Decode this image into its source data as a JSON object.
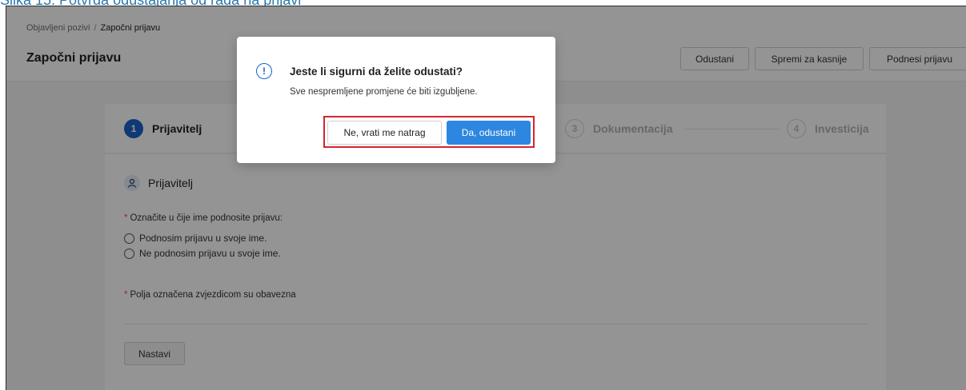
{
  "caption": "Slika 15. Potvrda odustajanja od rada na prijavi",
  "breadcrumb": {
    "parent": "Objavljeni pozivi",
    "separator": "/",
    "current": "Započni prijavu"
  },
  "page_title": "Započni prijavu",
  "header_buttons": {
    "cancel": "Odustani",
    "save_later": "Spremi za kasnije",
    "submit": "Podnesi prijavu"
  },
  "steps": [
    {
      "num": "1",
      "label": "Prijavitelj"
    },
    {
      "num": "3",
      "label": "Dokumentacija"
    },
    {
      "num": "4",
      "label": "Investicija"
    }
  ],
  "form": {
    "section_title": "Prijavitelj",
    "question": "Označite u čije ime podnosite prijavu:",
    "required_mark": "*",
    "options": [
      "Podnosim prijavu u svoje ime.",
      "Ne podnosim prijavu u svoje ime."
    ],
    "required_note": "Polja označena zvjezdicom su obavezna",
    "next_button": "Nastavi"
  },
  "modal": {
    "icon_glyph": "!",
    "title": "Jeste li sigurni da želite odustati?",
    "text": "Sve nespremljene promjene će biti izgubljene.",
    "cancel_button": "Ne, vrati me natrag",
    "confirm_button": "Da, odustani"
  },
  "colors": {
    "accent": "#1a62c9",
    "primary_button": "#2d86df",
    "highlight_border": "#d9232d",
    "required": "#e45757"
  },
  "icons": {
    "user": "user-icon",
    "warning": "exclamation-circle-icon"
  }
}
